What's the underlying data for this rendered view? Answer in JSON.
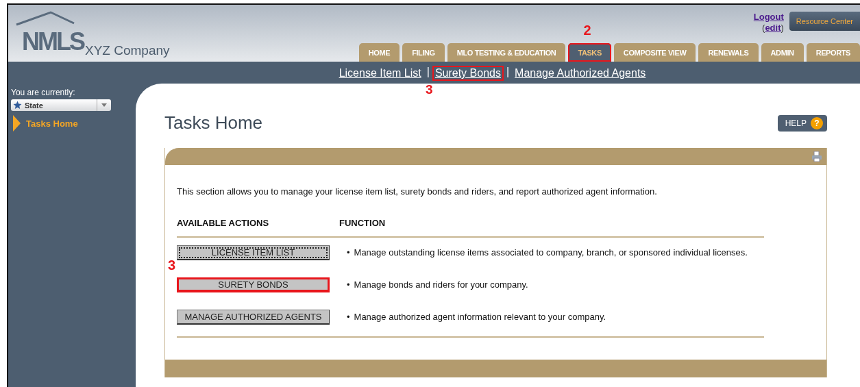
{
  "header": {
    "logo": "NMLS",
    "company": "XYZ Company",
    "logout": "Logout",
    "edit": {
      "open": "(",
      "link": "edit",
      "close": ")"
    },
    "resource_center": "Resource Center"
  },
  "tabs": [
    {
      "label": "HOME",
      "selected": false,
      "highlighted": false
    },
    {
      "label": "FILING",
      "selected": false,
      "highlighted": false
    },
    {
      "label": "MLO TESTING & EDUCATION",
      "selected": false,
      "highlighted": false
    },
    {
      "label": "TASKS",
      "selected": true,
      "highlighted": true,
      "callout": "2"
    },
    {
      "label": "COMPOSITE VIEW",
      "selected": false,
      "highlighted": false
    },
    {
      "label": "RENEWALS",
      "selected": false,
      "highlighted": false
    },
    {
      "label": "ADMIN",
      "selected": false,
      "highlighted": false
    },
    {
      "label": "REPORTS",
      "selected": false,
      "highlighted": false
    }
  ],
  "subnav": {
    "separator": "|",
    "links": [
      {
        "label": "License Item List",
        "highlighted": false
      },
      {
        "label": "Surety Bonds",
        "highlighted": true,
        "callout": "3"
      },
      {
        "label": "Manage Authorized Agents",
        "highlighted": false
      }
    ]
  },
  "sidebar": {
    "prompt": "You are currently:",
    "selector": "State",
    "items": [
      {
        "label": "Tasks Home",
        "selected": true
      }
    ]
  },
  "page_title": "Tasks Home",
  "help": {
    "label": "HELP",
    "icon": "?"
  },
  "card": {
    "intro": "This section allows you to manage your license item list, surety bonds and riders, and report authorized agent information.",
    "columns": [
      "AVAILABLE ACTIONS",
      "FUNCTION"
    ],
    "rows": [
      {
        "action": "LICENSE ITEM LIST",
        "bullet": "•",
        "function": "Manage outstanding license items associated to company, branch, or sponsored individual licenses.",
        "focused": true,
        "highlighted": false
      },
      {
        "action": "SURETY BONDS",
        "bullet": "•",
        "function": "Manage bonds and riders for your company.",
        "focused": false,
        "highlighted": true,
        "callout": "3"
      },
      {
        "action": "MANAGE AUTHORIZED AGENTS",
        "bullet": "•",
        "function": "Manage authorized agent information relevant to your company.",
        "focused": false,
        "highlighted": false
      }
    ]
  }
}
